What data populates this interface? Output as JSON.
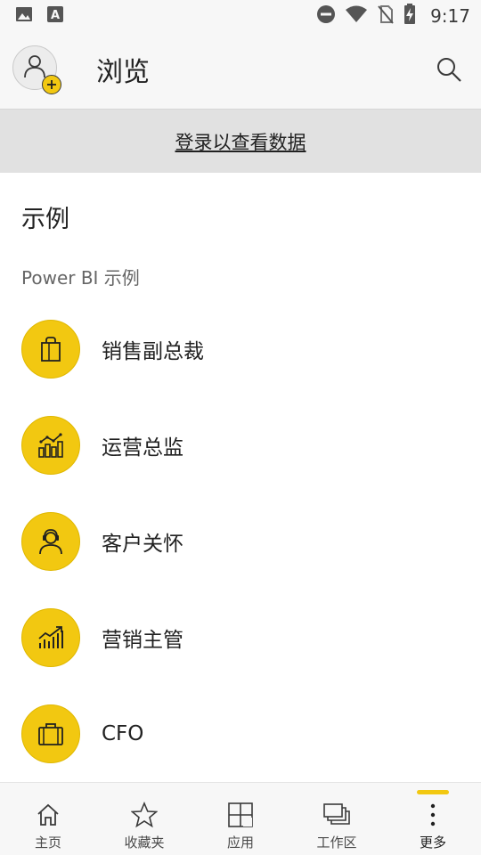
{
  "status_bar": {
    "time": "9:17",
    "icons": [
      "image-icon",
      "font-download-icon",
      "do-not-disturb-icon",
      "wifi-icon",
      "no-sim-icon",
      "battery-charging-icon"
    ]
  },
  "header": {
    "title": "浏览",
    "avatar_icon": "add-account-icon",
    "search_icon": "search-icon"
  },
  "banner": {
    "link_text": "登录以查看数据"
  },
  "main": {
    "section_title": "示例",
    "subsection_title": "Power BI 示例",
    "samples": [
      {
        "label": "销售副总裁",
        "icon": "shopping-bag-icon"
      },
      {
        "label": "运营总监",
        "icon": "bar-line-chart-icon"
      },
      {
        "label": "客户关怀",
        "icon": "headset-person-icon"
      },
      {
        "label": "营销主管",
        "icon": "growth-chart-icon"
      },
      {
        "label": "CFO",
        "icon": "briefcase-icon"
      }
    ]
  },
  "bottom_nav": {
    "items": [
      {
        "label": "主页",
        "icon": "home-icon"
      },
      {
        "label": "收藏夹",
        "icon": "star-icon"
      },
      {
        "label": "应用",
        "icon": "apps-icon"
      },
      {
        "label": "工作区",
        "icon": "workspaces-icon"
      },
      {
        "label": "更多",
        "icon": "more-vertical-icon",
        "active": true
      }
    ]
  },
  "colors": {
    "accent": "#f2c811",
    "banner_bg": "#e1e1e1",
    "bar_bg": "#f7f7f7"
  }
}
